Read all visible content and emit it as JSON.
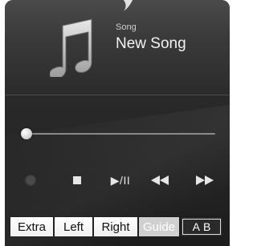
{
  "song": {
    "caption": "Song",
    "title": "New Song"
  },
  "playback": {
    "progress": 0
  },
  "controls": {
    "record": "record-icon",
    "stop": "stop-icon",
    "play_pause_label": "▶/II",
    "rewind": "rewind-icon",
    "fast_forward": "fast-forward-icon"
  },
  "tabs": {
    "extra": "Extra",
    "left": "Left",
    "right": "Right",
    "guide": "Guide",
    "ab_a": "A",
    "ab_b": "B"
  }
}
